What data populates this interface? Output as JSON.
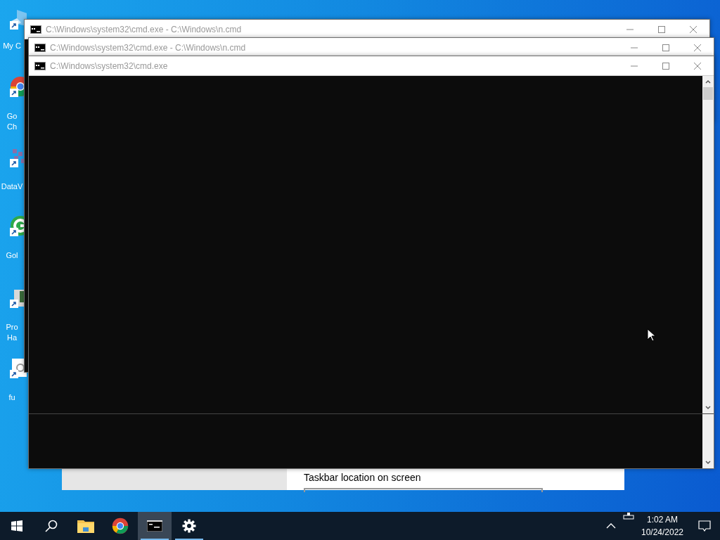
{
  "desktop_icons": [
    {
      "kind": "computer",
      "label_lines": [
        "My C"
      ]
    },
    {
      "kind": "browser",
      "label_lines": [
        "Go",
        "Ch"
      ]
    },
    {
      "kind": "grid",
      "label_lines": [
        "DataV"
      ]
    },
    {
      "kind": "green-circle",
      "label_lines": [
        "Gol"
      ]
    },
    {
      "kind": "device",
      "label_lines": [
        "Pro",
        "Ha"
      ]
    },
    {
      "kind": "document",
      "label_lines": [
        "fu"
      ]
    }
  ],
  "windows": [
    {
      "title": "C:\\Windows\\system32\\cmd.exe - C:\\Windows\\n.cmd"
    },
    {
      "title": "C:\\Windows\\system32\\cmd.exe - C:\\Windows\\n.cmd"
    },
    {
      "title": "C:\\Windows\\system32\\cmd.exe"
    }
  ],
  "settings_window": {
    "label": "Taskbar location on screen"
  },
  "taskbar": {
    "items": [
      {
        "kind": "start",
        "active": false,
        "running": false
      },
      {
        "kind": "search",
        "active": false,
        "running": false
      },
      {
        "kind": "explorer",
        "active": false,
        "running": false
      },
      {
        "kind": "chrome",
        "active": false,
        "running": false
      },
      {
        "kind": "cmd",
        "active": true,
        "running": true
      },
      {
        "kind": "settings",
        "active": false,
        "running": true
      }
    ],
    "time": "1:02 AM",
    "date": "10/24/2022"
  }
}
